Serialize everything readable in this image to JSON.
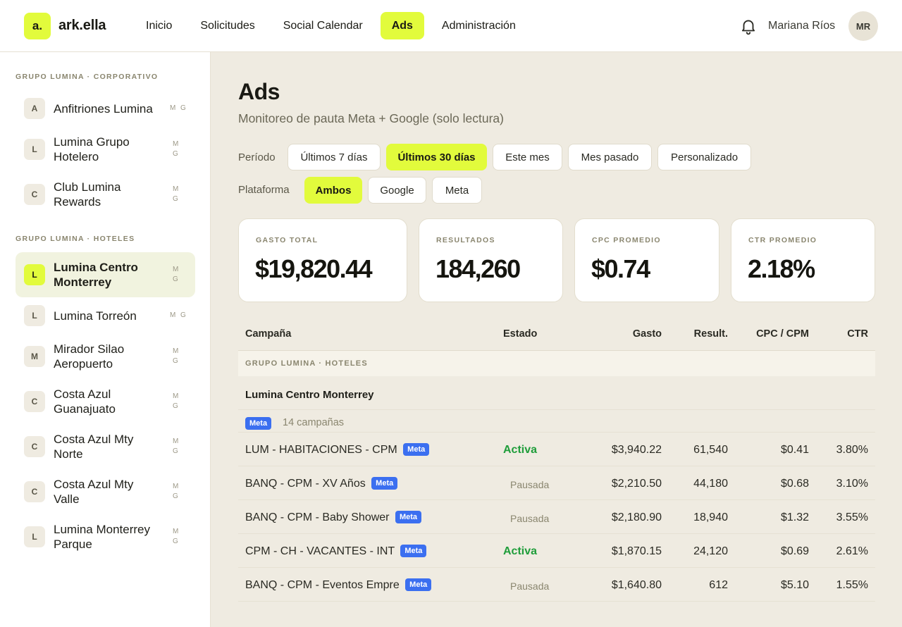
{
  "app": {
    "logo_mark": "a.",
    "name": "ark.ella"
  },
  "nav": [
    {
      "label": "Inicio",
      "active": false
    },
    {
      "label": "Solicitudes",
      "active": false
    },
    {
      "label": "Social Calendar",
      "active": false
    },
    {
      "label": "Ads",
      "active": true
    },
    {
      "label": "Administración",
      "active": false
    }
  ],
  "user": {
    "name": "Mariana Ríos",
    "initials": "MR"
  },
  "sidebar": {
    "groups": [
      {
        "label": "GRUPO LUMINA · CORPORATIVO",
        "items": [
          {
            "initial": "A",
            "name": "Anfitriones Lumina",
            "m": "M",
            "g": "G",
            "active": false
          },
          {
            "initial": "L",
            "name": "Lumina Grupo Hotelero",
            "m": "M",
            "g": "G",
            "active": false
          },
          {
            "initial": "C",
            "name": "Club Lumina Rewards",
            "m": "M",
            "g": "G",
            "active": false
          }
        ]
      },
      {
        "label": "GRUPO LUMINA · HOTELES",
        "items": [
          {
            "initial": "L",
            "name": "Lumina Centro Monterrey",
            "m": "M",
            "g": "G",
            "active": true
          },
          {
            "initial": "L",
            "name": "Lumina Torreón",
            "m": "M",
            "g": "G",
            "active": false
          },
          {
            "initial": "M",
            "name": "Mirador Silao Aeropuerto",
            "m": "M",
            "g": "G",
            "active": false
          },
          {
            "initial": "C",
            "name": "Costa Azul Guanajuato",
            "m": "M",
            "g": "G",
            "active": false
          },
          {
            "initial": "C",
            "name": "Costa Azul Mty Norte",
            "m": "M",
            "g": "G",
            "active": false
          },
          {
            "initial": "C",
            "name": "Costa Azul Mty Valle",
            "m": "M",
            "g": "G",
            "active": false
          },
          {
            "initial": "L",
            "name": "Lumina Monterrey Parque",
            "m": "M",
            "g": "G",
            "active": false
          }
        ]
      }
    ]
  },
  "page": {
    "title": "Ads",
    "subtitle": "Monitoreo de pauta Meta + Google (solo lectura)"
  },
  "filters": {
    "period_label": "Período",
    "periods": [
      {
        "label": "Últimos 7 días",
        "active": false
      },
      {
        "label": "Últimos 30 días",
        "active": true
      },
      {
        "label": "Este mes",
        "active": false
      },
      {
        "label": "Mes pasado",
        "active": false
      },
      {
        "label": "Personalizado",
        "active": false
      }
    ],
    "platform_label": "Plataforma",
    "platforms": [
      {
        "label": "Ambos",
        "active": true
      },
      {
        "label": "Google",
        "active": false
      },
      {
        "label": "Meta",
        "active": false
      }
    ]
  },
  "kpis": [
    {
      "label": "GASTO TOTAL",
      "value": "$19,820.44"
    },
    {
      "label": "RESULTADOS",
      "value": "184,260"
    },
    {
      "label": "CPC PROMEDIO",
      "value": "$0.74"
    },
    {
      "label": "CTR PROMEDIO",
      "value": "2.18%"
    }
  ],
  "table": {
    "headers": {
      "campaign": "Campaña",
      "status": "Estado",
      "spend": "Gasto",
      "results": "Result.",
      "cpc": "CPC / CPM",
      "ctr": "CTR"
    },
    "group_label": "GRUPO LUMINA · HOTELES",
    "account_name": "Lumina Centro Monterrey",
    "platform_badge": "Meta",
    "campaign_count": "14 campañas",
    "rows": [
      {
        "name": "LUM - HABITACIONES - CPM",
        "badge": "Meta",
        "status": "Activa",
        "active": true,
        "spend": "$3,940.22",
        "results": "61,540",
        "cpc": "$0.41",
        "ctr": "3.80%"
      },
      {
        "name": "BANQ - CPM - XV Años",
        "badge": "Meta",
        "status": "Pausada",
        "active": false,
        "spend": "$2,210.50",
        "results": "44,180",
        "cpc": "$0.68",
        "ctr": "3.10%"
      },
      {
        "name": "BANQ - CPM - Baby Shower",
        "badge": "Meta",
        "status": "Pausada",
        "active": false,
        "spend": "$2,180.90",
        "results": "18,940",
        "cpc": "$1.32",
        "ctr": "3.55%"
      },
      {
        "name": "CPM - CH - VACANTES - INT",
        "badge": "Meta",
        "status": "Activa",
        "active": true,
        "spend": "$1,870.15",
        "results": "24,120",
        "cpc": "$0.69",
        "ctr": "2.61%"
      },
      {
        "name": "BANQ - CPM - Eventos Empre",
        "badge": "Meta",
        "status": "Pausada",
        "active": false,
        "spend": "$1,640.80",
        "results": "612",
        "cpc": "$5.10",
        "ctr": "1.55%"
      }
    ]
  },
  "colors": {
    "accent": "#e2fb3c",
    "meta_badge": "#3b6ff0",
    "active_status": "#1f9d3a",
    "background": "#efebe1"
  }
}
